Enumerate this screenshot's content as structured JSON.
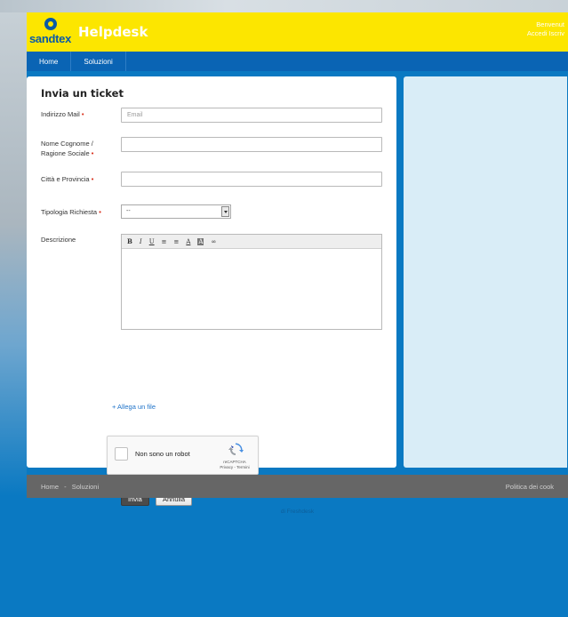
{
  "header": {
    "logo_text": "sandtex",
    "brand": "Helpdesk",
    "welcome": "Benvenut",
    "auth_links": "Accedi  Iscriv"
  },
  "nav": {
    "items": [
      "Home",
      "Soluzioni"
    ]
  },
  "form": {
    "title": "Invia un ticket",
    "email_label": "Indirizzo Mail",
    "email_placeholder": "Email",
    "name_label": "Nome Cognome / Ragione Sociale",
    "city_label": "Città e Provincia",
    "type_label": "Tipologia Richiesta",
    "type_selected": "--",
    "desc_label": "Descrizione",
    "toolbar": [
      "B",
      "I",
      "U",
      "≡",
      "≡",
      "A",
      "A",
      "∞"
    ],
    "attach_label": "+ Allega un file",
    "captcha_label": "Non sono un robot",
    "captcha_brand": "reCAPTCHA",
    "captcha_links": "Privacy - Termini",
    "submit_label": "Invia",
    "cancel_label": "Annulla",
    "required_mark": "•"
  },
  "footer": {
    "crumbs": [
      "Home",
      "Soluzioni"
    ],
    "separator": "-",
    "cookie_policy": "Politica dei cook",
    "powered_by": "di Freshdesk"
  },
  "colors": {
    "header_bg": "#fce600",
    "nav_bg": "#0a64b4",
    "page_bg": "#0a79c2",
    "sidebar_bg": "#d9edf7",
    "required": "#d9331f"
  }
}
